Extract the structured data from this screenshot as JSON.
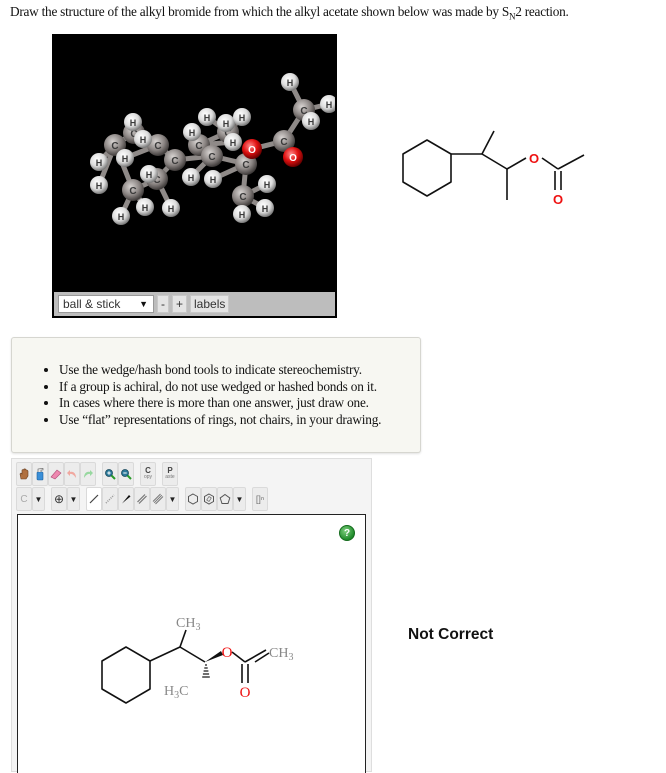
{
  "question": {
    "text_before": "Draw the structure of the alkyl bromide from which the alkyl acetate shown below was made by S",
    "subscript": "N",
    "text_after": "2 reaction."
  },
  "viewer_3d": {
    "style_option": "ball & stick",
    "minus_label": "-",
    "plus_label": "+",
    "labels_label": "labels",
    "atom_labels": {
      "carbon": "C",
      "hydrogen": "H",
      "oxygen": "O"
    },
    "colors": {
      "background": "#000000",
      "carbon": "#8a8482",
      "hydrogen": "#e6e6e6",
      "oxygen": "#dd1111"
    }
  },
  "reference_structure": {
    "name": "alkyl acetate (3-cyclohexylbutan-2-yl acetate)",
    "oxygen_label": "O",
    "carbonyl_oxygen_label": "O",
    "heteroatom_color": "#ee1111"
  },
  "instructions": [
    "Use the wedge/hash bond tools to indicate stereochemistry.",
    "If a group is achiral, do not use wedged or hashed bonds on it.",
    "In cases where there is more than one answer, just draw one.",
    "Use “flat” representations of rings, not chairs, in your drawing."
  ],
  "editor": {
    "toolbar_row1": [
      {
        "name": "move-tool",
        "icon": "hand-icon"
      },
      {
        "name": "erase-all-tool",
        "icon": "spray-bottle-icon"
      },
      {
        "name": "eraser-tool",
        "icon": "eraser-icon"
      },
      {
        "name": "undo",
        "icon": "undo-icon"
      },
      {
        "name": "redo",
        "icon": "redo-icon"
      },
      {
        "name": "zoom-in",
        "icon": "zoom-in-icon"
      },
      {
        "name": "zoom-out",
        "icon": "zoom-out-icon"
      },
      {
        "name": "copy",
        "icon": "copy-icon",
        "label": "C",
        "sublabel": "opy"
      },
      {
        "name": "paste",
        "icon": "paste-icon",
        "label": "P",
        "sublabel": "aste"
      }
    ],
    "atom_tool_label": "C",
    "charge_tool_label": "⊕",
    "bracket_tool_label": "[]ⁿ",
    "help_label": "?",
    "drawn_structure": {
      "labels": {
        "methyl_top": "CH3",
        "methyl_right": "CH3",
        "methyl_hashed": "H3C",
        "ester_oxygen": "O",
        "carbonyl_oxygen": "O"
      },
      "label_color": "#888888",
      "oxygen_color": "#ee1111"
    }
  },
  "result": {
    "status": "Not Correct"
  }
}
